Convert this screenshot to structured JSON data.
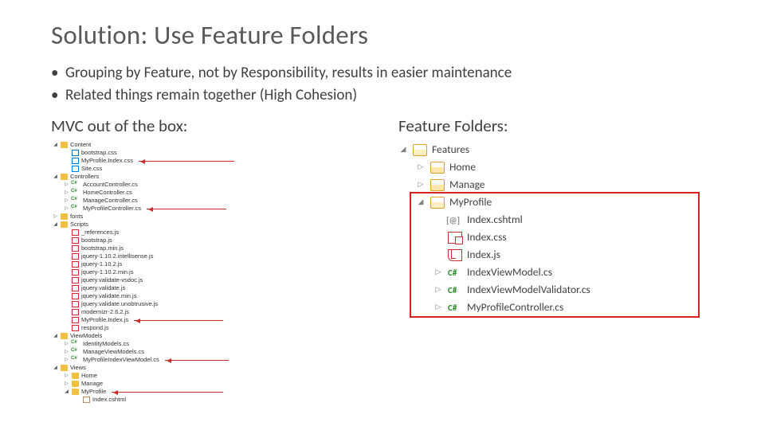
{
  "title": "Solution: Use Feature Folders",
  "bullets": {
    "b1": "Grouping by Feature, not by Responsibility, results in easier maintenance",
    "b2": "Related things remain together (High Cohesion)"
  },
  "left": {
    "heading": "MVC out of the box:",
    "tree": {
      "content": {
        "name": "Content",
        "files": [
          "bootstrap.css",
          "MyProfile.Index.css",
          "Site.css"
        ]
      },
      "controllers": {
        "name": "Controllers",
        "files": [
          "AccountController.cs",
          "HomeController.cs",
          "ManageController.cs",
          "MyProfileController.cs"
        ]
      },
      "fonts": "fonts",
      "scripts": {
        "name": "Scripts",
        "files": [
          "_references.js",
          "bootstrap.js",
          "bootstrap.min.js",
          "jquery-1.10.2.intellisense.js",
          "jquery-1.10.2.js",
          "jquery-1.10.2.min.js",
          "jquery.validate-vsdoc.js",
          "jquery.validate.js",
          "jquery.validate.min.js",
          "jquery.validate.unobtrusive.js",
          "modernizr-2.6.2.js",
          "MyProfile.Index.js",
          "respond.js"
        ]
      },
      "viewmodels": {
        "name": "ViewModels",
        "files": [
          "IdentityModels.cs",
          "ManageViewModels.cs",
          "MyProfileIndexViewModel.cs"
        ]
      },
      "views": {
        "name": "Views",
        "folders": [
          "Home",
          "Manage",
          "MyProfile"
        ],
        "file": "Index.cshtml"
      }
    }
  },
  "right": {
    "heading": "Feature Folders:",
    "tree": {
      "root": "Features",
      "home": "Home",
      "manage": "Manage",
      "myprofile": {
        "name": "MyProfile",
        "files": {
          "cshtml": "Index.cshtml",
          "css": "Index.css",
          "js": "Index.js",
          "vm": "IndexViewModel.cs",
          "val": "IndexViewModelValidator.cs",
          "ctrl": "MyProfileController.cs"
        }
      }
    }
  }
}
